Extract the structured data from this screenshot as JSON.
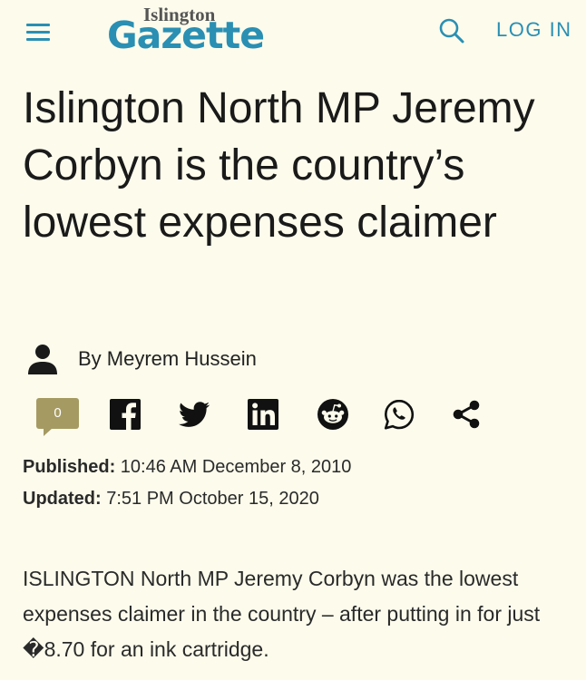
{
  "header": {
    "logo_small": "Islington",
    "logo_big": "Gazette",
    "login_label": "LOG IN",
    "menu_icon": "hamburger-menu-icon",
    "search_icon": "search-icon",
    "accent_color": "#2a8fb3"
  },
  "article": {
    "headline": "Islington North MP Jeremy Corbyn is the country’s lowest expenses claimer",
    "author": "By Meyrem Hussein",
    "comment_count": "0",
    "share_icons": [
      "facebook-icon",
      "twitter-icon",
      "linkedin-icon",
      "reddit-icon",
      "whatsapp-icon",
      "share-icon"
    ],
    "published_label": "Published:",
    "published_value": "10:46 AM December 8, 2010",
    "updated_label": "Updated:",
    "updated_value": "7:51 PM October 15, 2020",
    "body": "ISLINGTON North MP Jeremy Corbyn was the lowest expenses claimer in the country – after putting in for just �8.70 for an ink cartridge."
  }
}
